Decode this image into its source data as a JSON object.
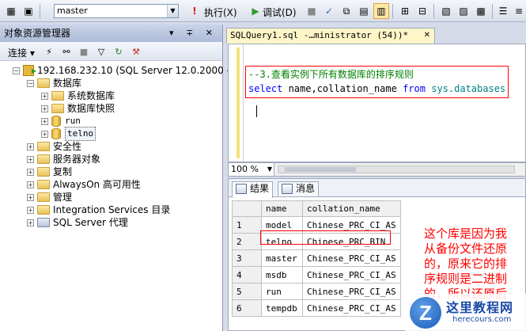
{
  "toolbar": {
    "database": "master",
    "execute_label": "执行(X)",
    "debug_label": "调试(D)"
  },
  "object_explorer": {
    "title": "对象资源管理器",
    "title_controls": "▾ ∓ ✕",
    "connect_label": "连接",
    "server": "192.168.232.10 (SQL Server 12.0.2000 -",
    "nodes": {
      "databases": "数据库",
      "system_databases": "系统数据库",
      "snapshots": "数据库快照",
      "run": "run",
      "telno": "telno",
      "security": "安全性",
      "server_objects": "服务器对象",
      "replication": "复制",
      "alwayson": "AlwaysOn 高可用性",
      "management": "管理",
      "integration": "Integration Services 目录",
      "agent": "SQL Server 代理"
    }
  },
  "editor": {
    "tab_title": "SQLQuery1.sql -…ministrator (54))*",
    "tab_close": "✕",
    "comment_line": "--3.查看实例下所有数据库的排序规则",
    "code": {
      "kw_select": "select",
      "columns": " name,collation_name ",
      "kw_from": "from",
      "space": " ",
      "table": "sys.databases"
    },
    "zoom": "100 %"
  },
  "results": {
    "tab_results": "结果",
    "tab_messages": "消息",
    "columns": [
      "name",
      "collation_name"
    ],
    "rows": [
      {
        "n": "1",
        "name": "model",
        "collation": "Chinese_PRC_CI_AS"
      },
      {
        "n": "2",
        "name": "telno",
        "collation": "Chinese_PRC_BIN"
      },
      {
        "n": "3",
        "name": "master",
        "collation": "Chinese_PRC_CI_AS"
      },
      {
        "n": "4",
        "name": "msdb",
        "collation": "Chinese_PRC_CI_AS"
      },
      {
        "n": "5",
        "name": "run",
        "collation": "Chinese_PRC_CI_AS"
      },
      {
        "n": "6",
        "name": "tempdb",
        "collation": "Chinese_PRC_CI_AS"
      }
    ]
  },
  "annotation": "这个库是因为我从备份文件还原的，原来它的排序规则是二进制的，所以还原后",
  "watermark": {
    "logo_letter": "Z",
    "title": "这里教程网",
    "url": "herecours.com"
  },
  "colors": {
    "annotation": "#ff0000",
    "keyword": "#0000ff",
    "comment": "#008000",
    "system_object": "#008080"
  }
}
